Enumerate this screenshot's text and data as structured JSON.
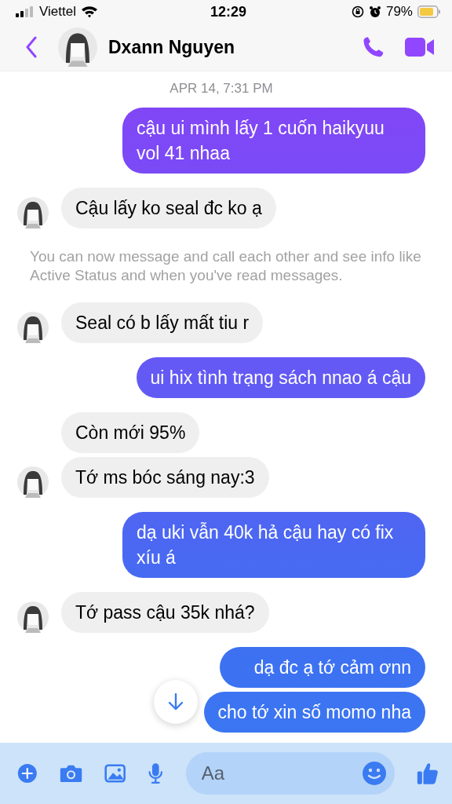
{
  "status_bar": {
    "carrier": "Viettel",
    "time": "12:29",
    "battery": "79%"
  },
  "header": {
    "name": "Dxann Nguyen"
  },
  "timestamp": "APR 14, 7:31 PM",
  "messages": [
    {
      "kind": "outgoing",
      "text": "cậu ui mình lấy 1 cuốn haikyuu vol 41 nhaa"
    },
    {
      "kind": "incoming",
      "text": "Cậu lấy ko seal đc ko ạ",
      "avatar": true
    },
    {
      "kind": "notice",
      "text": "You can now message and call each other and see info like Active Status and when you've read messages."
    },
    {
      "kind": "incoming",
      "text": "Seal có b lấy mất tiu r",
      "avatar": true
    },
    {
      "kind": "outgoing",
      "text": "ui hix tình trạng sách nnao á cậu"
    },
    {
      "kind": "incoming",
      "text": "Còn mới 95%",
      "avatar": false
    },
    {
      "kind": "incoming",
      "text": "Tớ ms bóc sáng nay:3",
      "avatar": true
    },
    {
      "kind": "outgoing",
      "text": "dạ uki vẫn 40k hả cậu hay có fix xíu á"
    },
    {
      "kind": "incoming",
      "text": "Tớ pass cậu 35k nhá?",
      "avatar": true
    },
    {
      "kind": "outgoing",
      "text": "dạ đc ạ tớ cảm ơnn"
    },
    {
      "kind": "outgoing",
      "text": "cho tớ xin số momo nha"
    }
  ],
  "composer": {
    "placeholder": "Aa"
  }
}
